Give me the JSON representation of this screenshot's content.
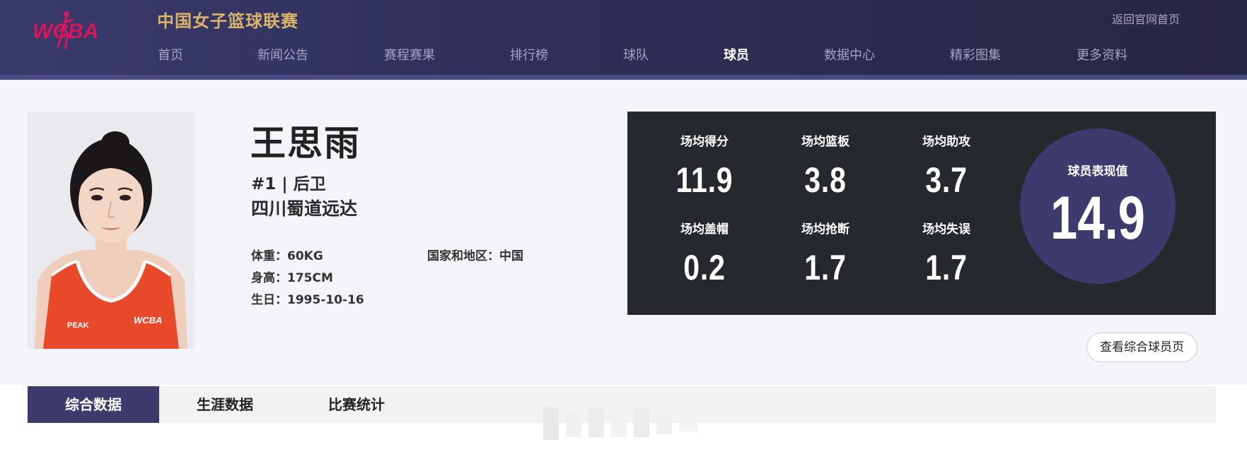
{
  "header": {
    "logo_text": "WCBA",
    "site_title": "中国女子篮球联赛",
    "back_home": "返回官网首页",
    "nav": [
      {
        "label": "首页",
        "active": false
      },
      {
        "label": "新闻公告",
        "active": false
      },
      {
        "label": "赛程赛果",
        "active": false
      },
      {
        "label": "排行榜",
        "active": false
      },
      {
        "label": "球队",
        "active": false
      },
      {
        "label": "球员",
        "active": true
      },
      {
        "label": "数据中心",
        "active": false
      },
      {
        "label": "精彩图集",
        "active": false
      },
      {
        "label": "更多资料",
        "active": false
      }
    ]
  },
  "player": {
    "name": "王思雨",
    "number_position": "#1 | 后卫",
    "team": "四川蜀道远达",
    "weight": "体重：60KG",
    "height": "身高：175CM",
    "birthday": "生日：1995-10-16",
    "country": "国家和地区：中国",
    "jersey_logo_left": "PEAK",
    "jersey_logo_right": "WCBA"
  },
  "stats": {
    "items": [
      {
        "label": "场均得分",
        "value": "11.9"
      },
      {
        "label": "场均篮板",
        "value": "3.8"
      },
      {
        "label": "场均助攻",
        "value": "3.7"
      },
      {
        "label": "场均盖帽",
        "value": "0.2"
      },
      {
        "label": "场均抢断",
        "value": "1.7"
      },
      {
        "label": "场均失误",
        "value": "1.7"
      }
    ],
    "performance_label": "球员表现值",
    "performance_value": "14.9"
  },
  "view_button": "查看综合球员页",
  "tabs": [
    {
      "label": "综合数据",
      "active": true
    },
    {
      "label": "生涯数据",
      "active": false
    },
    {
      "label": "比赛统计",
      "active": false
    }
  ],
  "colors": {
    "header": "#2f2e56",
    "accent_gold": "#d9b469",
    "logo_magenta": "#d6175c",
    "panel": "#25292d",
    "circle": "#3d3b6e",
    "jersey": "#e8492a"
  }
}
